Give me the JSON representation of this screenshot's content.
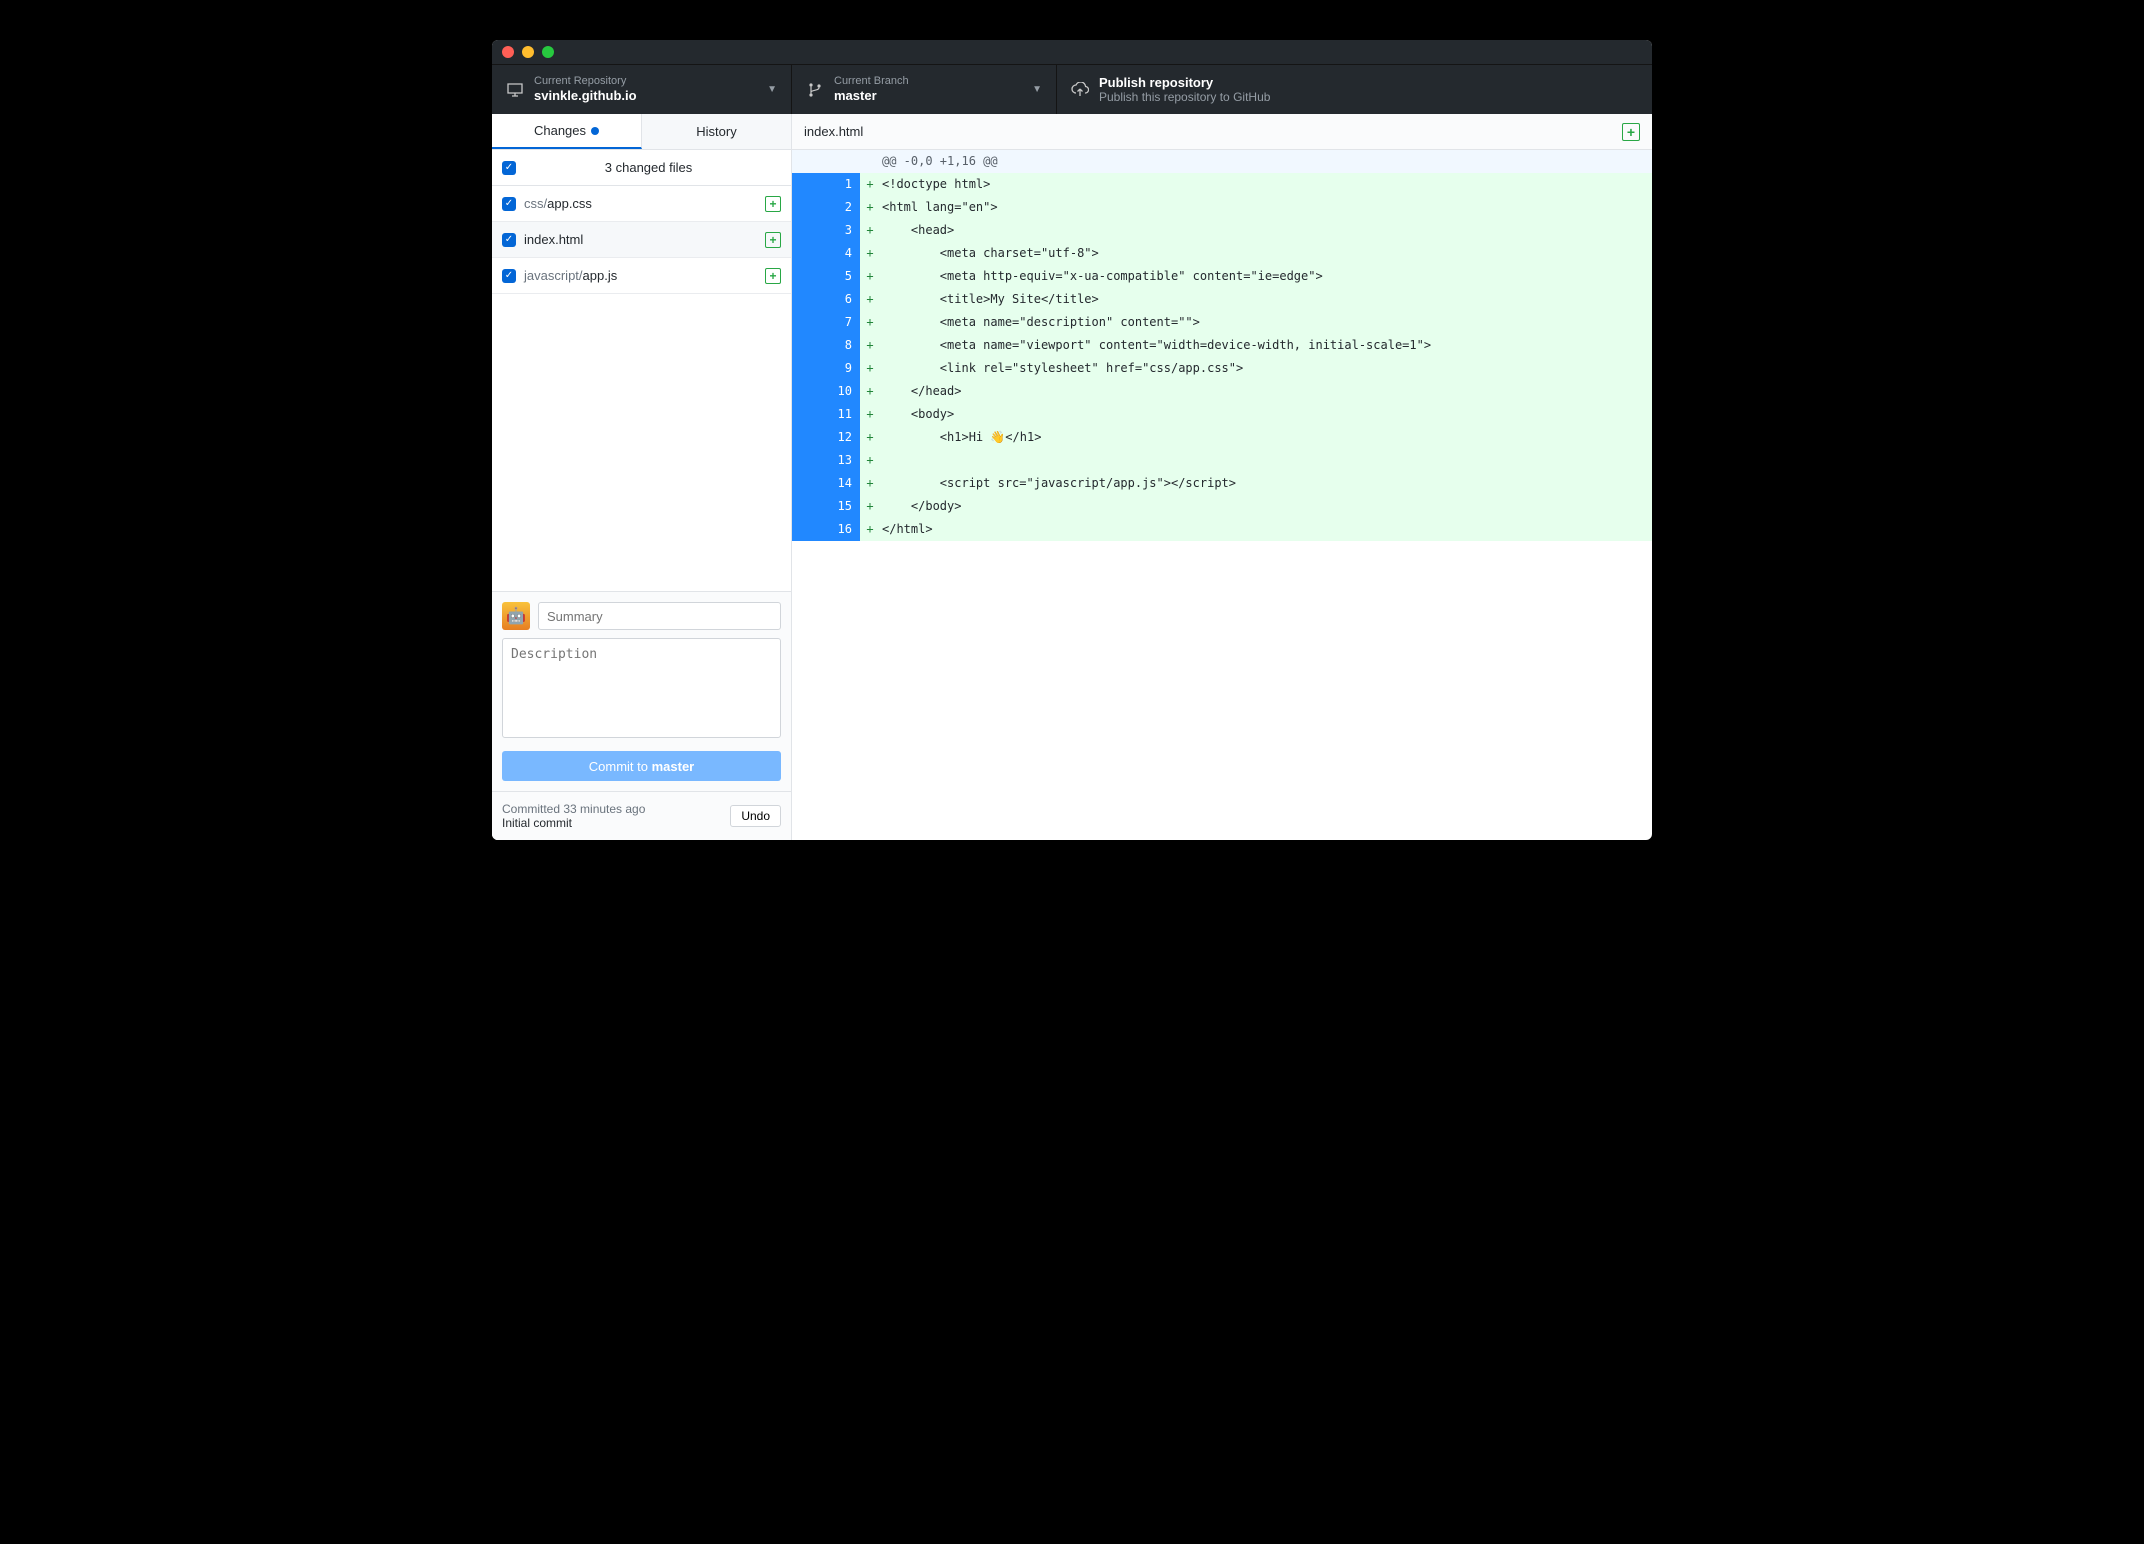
{
  "toolbar": {
    "repo": {
      "label": "Current Repository",
      "value": "svinkle.github.io"
    },
    "branch": {
      "label": "Current Branch",
      "value": "master"
    },
    "publish": {
      "title": "Publish repository",
      "subtitle": "Publish this repository to GitHub"
    }
  },
  "sidebar": {
    "tabs": {
      "changes": "Changes",
      "history": "History"
    },
    "changed_files_label": "3 changed files",
    "files": [
      {
        "dir": "css/",
        "name": "app.css",
        "status": "+"
      },
      {
        "dir": "",
        "name": "index.html",
        "status": "+"
      },
      {
        "dir": "javascript/",
        "name": "app.js",
        "status": "+"
      }
    ],
    "commit": {
      "summary_placeholder": "Summary",
      "description_placeholder": "Description",
      "button_prefix": "Commit to ",
      "button_branch": "master"
    },
    "last_commit": {
      "line1": "Committed 33 minutes ago",
      "line2": "Initial commit",
      "undo": "Undo"
    }
  },
  "main": {
    "filename": "index.html",
    "hunk_header": "@@ -0,0 +1,16 @@",
    "lines": [
      {
        "n": 1,
        "text": "<!doctype html>"
      },
      {
        "n": 2,
        "text": "<html lang=\"en\">"
      },
      {
        "n": 3,
        "text": "    <head>"
      },
      {
        "n": 4,
        "text": "        <meta charset=\"utf-8\">"
      },
      {
        "n": 5,
        "text": "        <meta http-equiv=\"x-ua-compatible\" content=\"ie=edge\">"
      },
      {
        "n": 6,
        "text": "        <title>My Site</title>"
      },
      {
        "n": 7,
        "text": "        <meta name=\"description\" content=\"\">"
      },
      {
        "n": 8,
        "text": "        <meta name=\"viewport\" content=\"width=device-width, initial-scale=1\">"
      },
      {
        "n": 9,
        "text": "        <link rel=\"stylesheet\" href=\"css/app.css\">"
      },
      {
        "n": 10,
        "text": "    </head>"
      },
      {
        "n": 11,
        "text": "    <body>"
      },
      {
        "n": 12,
        "text": "        <h1>Hi 👋</h1>"
      },
      {
        "n": 13,
        "text": ""
      },
      {
        "n": 14,
        "text": "        <script src=\"javascript/app.js\"></script>"
      },
      {
        "n": 15,
        "text": "    </body>"
      },
      {
        "n": 16,
        "text": "</html>"
      }
    ]
  }
}
